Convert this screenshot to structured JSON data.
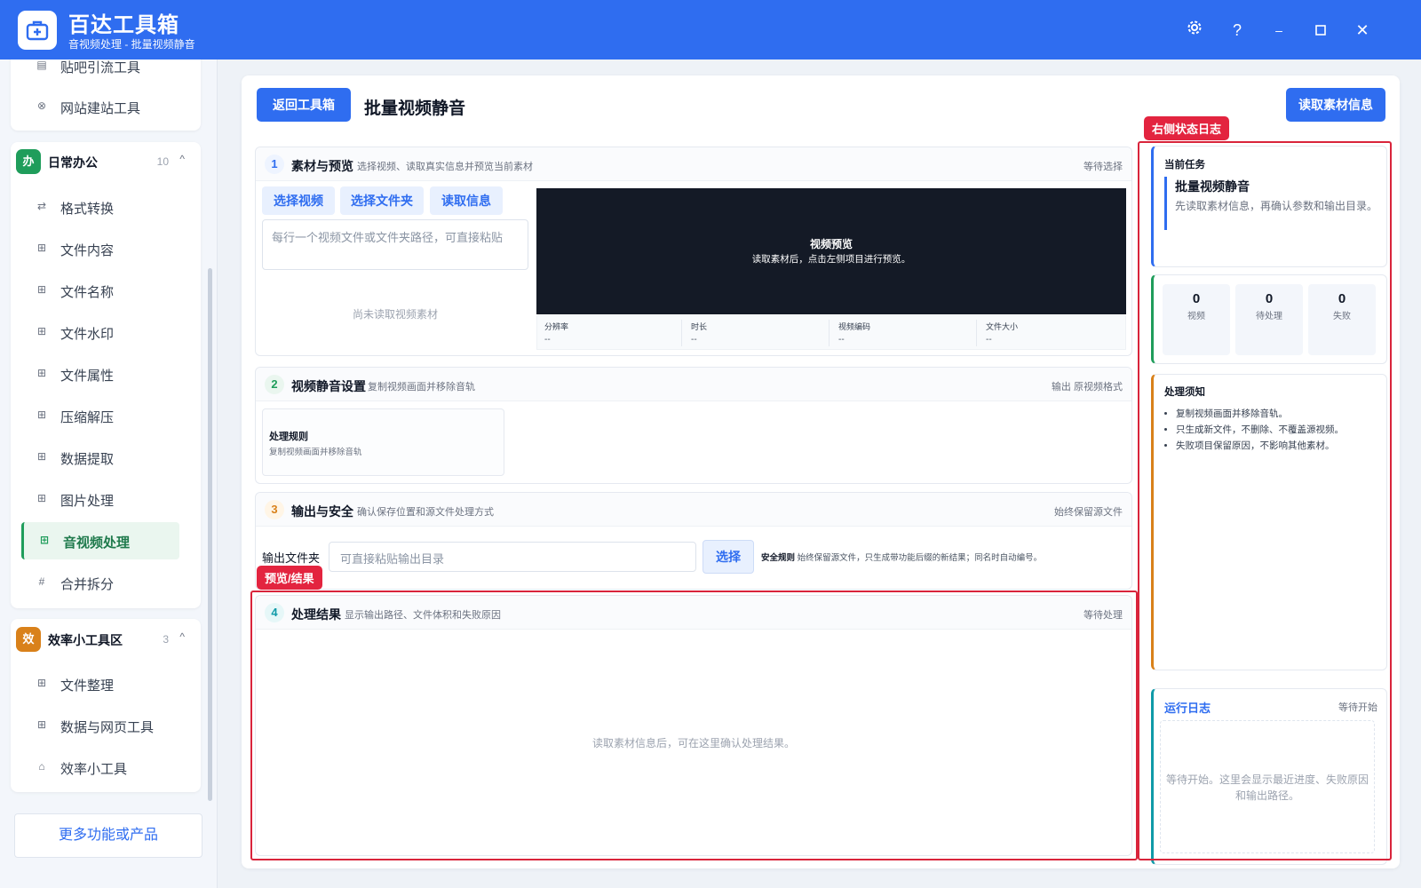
{
  "app": {
    "title": "百达工具箱",
    "subtitle": "音视频处理 - 批量视频静音",
    "brand_color": "#2f6df0",
    "window_controls": [
      "gear-icon",
      "help-icon",
      "minimize-icon",
      "maximize-icon",
      "close-icon"
    ]
  },
  "sidebar": {
    "top_items": [
      {
        "label": "贴吧引流工具",
        "icon": "doc-icon"
      },
      {
        "label": "网站建站工具",
        "icon": "globe-icon"
      }
    ],
    "group_office": {
      "badge": "办",
      "badge_color": "#1f9d5b",
      "title": "日常办公",
      "count": "10",
      "items": [
        {
          "label": "格式转换",
          "icon": "swap-icon"
        },
        {
          "label": "文件内容",
          "icon": "grid-icon"
        },
        {
          "label": "文件名称",
          "icon": "grid-icon"
        },
        {
          "label": "文件水印",
          "icon": "grid-icon"
        },
        {
          "label": "文件属性",
          "icon": "grid-icon"
        },
        {
          "label": "压缩解压",
          "icon": "grid-icon"
        },
        {
          "label": "数据提取",
          "icon": "grid-icon"
        },
        {
          "label": "图片处理",
          "icon": "grid-icon"
        },
        {
          "label": "音视频处理",
          "icon": "grid-icon",
          "active": true
        },
        {
          "label": "合并拆分",
          "icon": "hash-icon"
        }
      ]
    },
    "group_tools": {
      "badge": "效",
      "badge_color": "#d9811a",
      "title": "效率小工具区",
      "count": "3",
      "items": [
        {
          "label": "文件整理",
          "icon": "grid-icon"
        },
        {
          "label": "数据与网页工具",
          "icon": "grid-icon"
        },
        {
          "label": "效率小工具",
          "icon": "toolbox-icon"
        }
      ]
    },
    "more_label": "更多功能或产品"
  },
  "header": {
    "back_label": "返回工具箱",
    "page_title": "批量视频静音",
    "read_info_label": "读取素材信息"
  },
  "section1": {
    "num": "1",
    "title": "素材与预览",
    "desc": "选择视频、读取真实信息并预览当前素材",
    "status": "等待选择",
    "buttons": [
      "选择视频",
      "选择文件夹",
      "读取信息"
    ],
    "path_placeholder": "每行一个视频文件或文件夹路径，可直接粘贴",
    "empty_text": "尚未读取视频素材",
    "preview_title": "视频预览",
    "preview_hint": "读取素材后，点击左侧项目进行预览。",
    "meta": [
      {
        "label": "分辨率",
        "value": "--"
      },
      {
        "label": "时长",
        "value": "--"
      },
      {
        "label": "视频编码",
        "value": "--"
      },
      {
        "label": "文件大小",
        "value": "--"
      }
    ]
  },
  "section2": {
    "num": "2",
    "title": "视频静音设置",
    "desc": "复制视频画面并移除音轨",
    "status": "输出 原视频格式",
    "rule_title": "处理规则",
    "rule_desc": "复制视频画面并移除音轨"
  },
  "section3": {
    "num": "3",
    "title": "输出与安全",
    "desc": "确认保存位置和源文件处理方式",
    "status": "始终保留源文件",
    "output_label": "输出文件夹",
    "output_placeholder": "可直接粘贴输出目录",
    "select_label": "选择",
    "safety_title": "安全规则",
    "safety_desc": "始终保留源文件，只生成带功能后缀的新结果；同名时自动编号。"
  },
  "section4": {
    "num": "4",
    "title": "处理结果",
    "desc": "显示输出路径、文件体积和失败原因",
    "status": "等待处理",
    "empty_text": "读取素材信息后，可在这里确认处理结果。"
  },
  "right": {
    "task_label": "当前任务",
    "task_title": "批量视频静音",
    "task_desc": "先读取素材信息，再确认参数和输出目录。",
    "stats": [
      {
        "value": "0",
        "label": "视频"
      },
      {
        "value": "0",
        "label": "待处理"
      },
      {
        "value": "0",
        "label": "失败"
      }
    ],
    "tips_title": "处理须知",
    "tips": [
      "复制视频画面并移除音轨。",
      "只生成新文件，不删除、不覆盖源视频。",
      "失败项目保留原因，不影响其他素材。"
    ],
    "log_title": "运行日志",
    "log_status": "等待开始",
    "log_empty": "等待开始。这里会显示最近进度、失败原因和输出路径。"
  },
  "annotations": {
    "right_log_tag": "右侧状态日志",
    "result_tag": "预览/结果",
    "color": "#d9243b"
  }
}
